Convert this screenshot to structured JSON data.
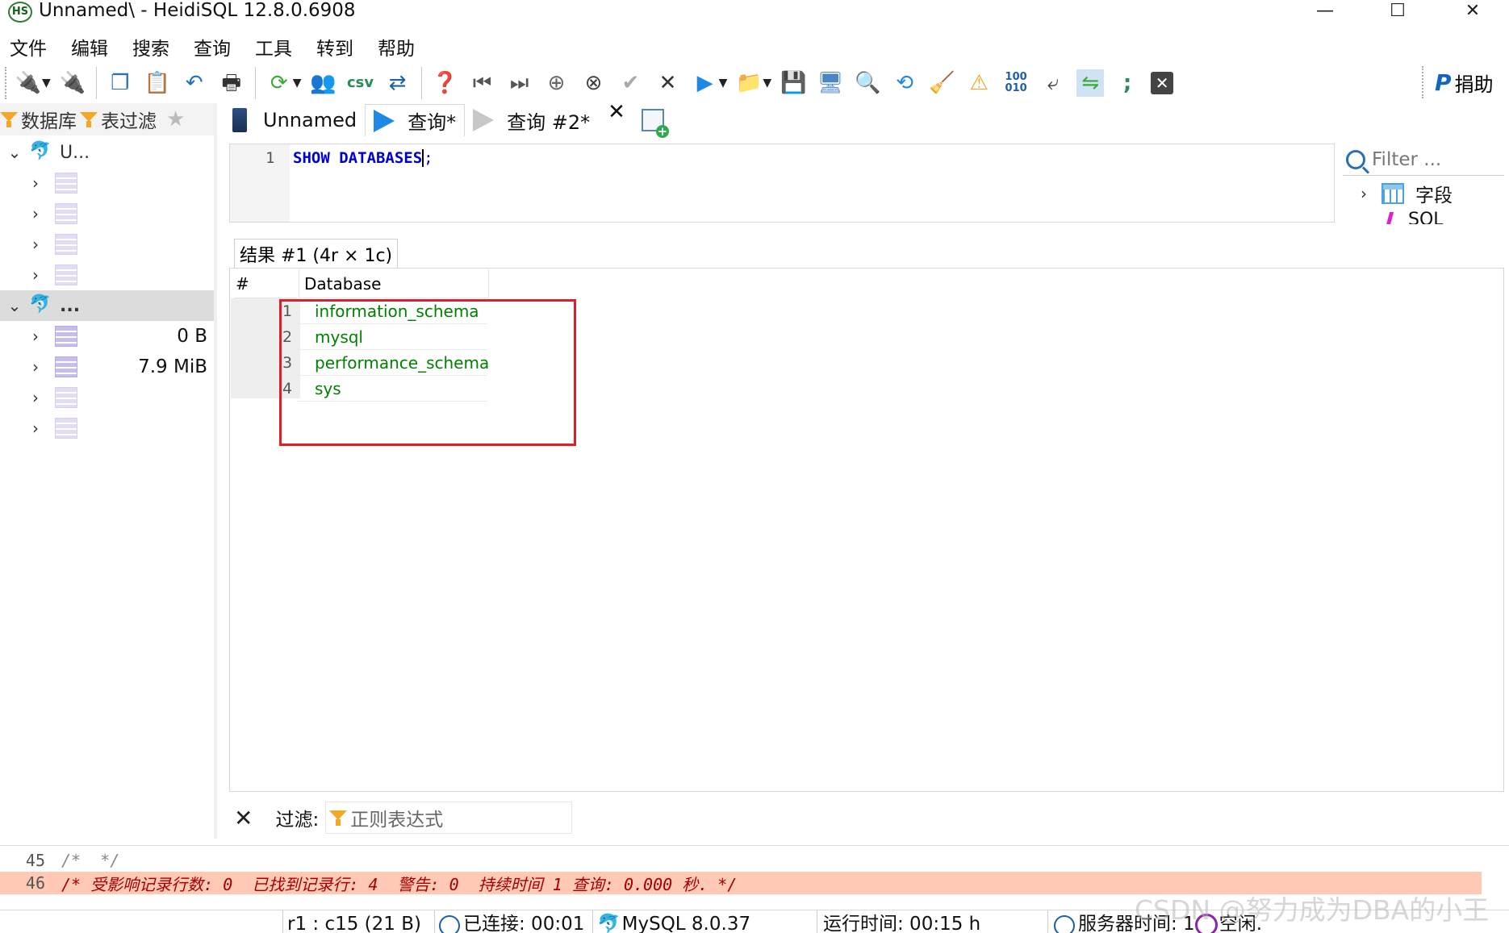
{
  "window": {
    "title": "Unnamed\\ - HeidiSQL 12.8.0.6908",
    "logo_text": "HS",
    "controls": [
      "—",
      "☐",
      "✕"
    ]
  },
  "menu": [
    "文件",
    "编辑",
    "搜索",
    "查询",
    "工具",
    "转到",
    "帮助"
  ],
  "toolbar": {
    "icons": [
      "connect-plug-icon",
      "disconnect-plug-icon",
      "copy-icon",
      "paste-icon",
      "undo-icon",
      "print-icon",
      "refresh-icon",
      "user-manager-icon",
      "export-csv-icon",
      "sync-icon",
      "help-icon",
      "first-record-icon",
      "last-record-icon",
      "add-record-icon",
      "delete-record-icon",
      "post-record-icon",
      "cancel-icon",
      "run-icon",
      "open-folder-icon",
      "save-icon",
      "load-icon",
      "find-icon",
      "replace-icon",
      "clear-icon",
      "warning-icon",
      "binary-icon",
      "wrap-icon",
      "format-icon",
      "semicolon-icon",
      "stop-icon"
    ],
    "donate_label": "捐助",
    "donate_logo": "P"
  },
  "left": {
    "tabs": [
      {
        "label": "数据库"
      },
      {
        "label": "表过滤"
      }
    ],
    "tree": [
      {
        "chev": "⌄",
        "label": "U...",
        "level": "server"
      },
      {
        "chev": "›",
        "size": "",
        "level": "db"
      },
      {
        "chev": "›",
        "size": "",
        "level": "db"
      },
      {
        "chev": "›",
        "size": "",
        "level": "db"
      },
      {
        "chev": "›",
        "size": "",
        "level": "db"
      },
      {
        "chev": "⌄",
        "label": "...",
        "level": "server"
      },
      {
        "chev": "›",
        "size": "0 B",
        "level": "db"
      },
      {
        "chev": "›",
        "size": "7.9 MiB",
        "level": "db"
      },
      {
        "chev": "›",
        "size": "",
        "level": "db"
      },
      {
        "chev": "›",
        "size": "",
        "level": "db"
      }
    ]
  },
  "query_tabs": [
    {
      "label": "Unnamed"
    },
    {
      "label": "查询*"
    },
    {
      "label": "查询 #2*"
    }
  ],
  "editor": {
    "line_no": "1",
    "keyword1": "SHOW",
    "keyword2": "DATABASES",
    "punct": ";"
  },
  "helper": {
    "filter_placeholder": "Filter ...",
    "fields_label": "字段",
    "sql_label": "SQL"
  },
  "result": {
    "tab_label": "结果 #1 (4r × 1c)",
    "columns": [
      "#",
      "Database"
    ],
    "rows": [
      {
        "n": "1",
        "db": "information_schema"
      },
      {
        "n": "2",
        "db": "mysql"
      },
      {
        "n": "3",
        "db": "performance_schema"
      },
      {
        "n": "4",
        "db": "sys"
      }
    ]
  },
  "filterbar": {
    "close": "✕",
    "label": "过滤:",
    "placeholder": "正则表达式"
  },
  "log": [
    {
      "no": "45",
      "text": "/*  */"
    },
    {
      "no": "46",
      "text": "/* 受影响记录行数: 0  已找到记录行: 4  警告: 0  持续时间 1 查询: 0.000 秒. */"
    }
  ],
  "status": {
    "cursor": "r1 : c15 (21 B)",
    "connected": "已连接: 00:01",
    "server": "MySQL 8.0.37",
    "uptime": "运行时间: 00:15 h",
    "server_time": "服务器时间: 1",
    "state": "空闲."
  },
  "watermark": "CSDN @努力成为DBA的小王",
  "colors": {
    "keyword": "#0000cc",
    "result_value": "#008000",
    "highlight_border": "#e11d2a",
    "log_highlight": "#ffc9b5"
  }
}
